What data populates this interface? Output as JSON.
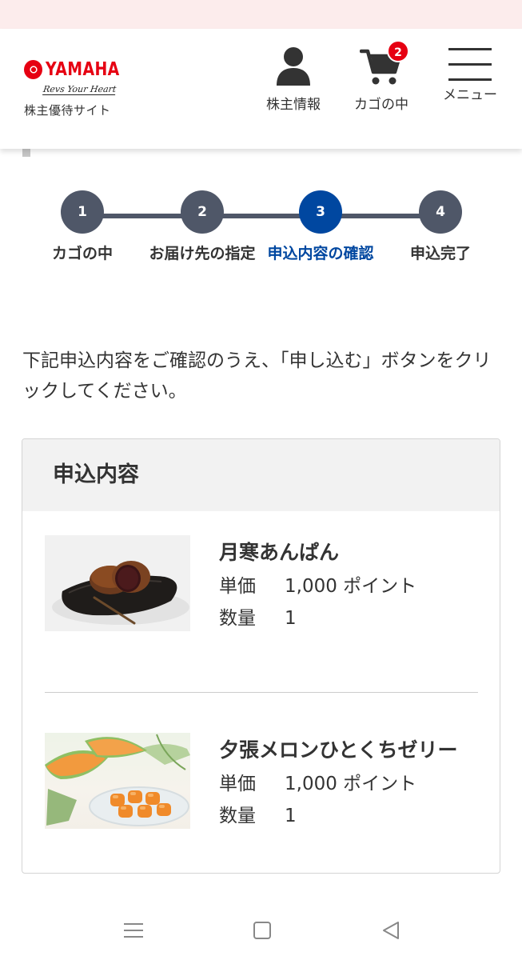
{
  "header": {
    "logo_text": "YAMAHA",
    "logo_tagline": "Revs Your Heart",
    "site_name": "株主優待サイト",
    "nav": {
      "user_label": "株主情報",
      "cart_label": "カゴの中",
      "cart_count": "2",
      "menu_label": "メニュー"
    }
  },
  "steps": [
    {
      "number": "1",
      "label": "カゴの中"
    },
    {
      "number": "2",
      "label": "お届け先の指定"
    },
    {
      "number": "3",
      "label": "申込内容の確認"
    },
    {
      "number": "4",
      "label": "申込完了"
    }
  ],
  "active_step": "3",
  "instruction": "下記申込内容をご確認のうえ、「申し込む」ボタンをクリックしてください。",
  "order": {
    "heading": "申込内容",
    "price_label": "単価",
    "qty_label": "数量",
    "items": [
      {
        "name": "月寒あんぱん",
        "price": "1,000 ポイント",
        "quantity": "1"
      },
      {
        "name": "夕張メロンひとくちゼリー",
        "price": "1,000 ポイント",
        "quantity": "1"
      }
    ]
  },
  "colors": {
    "brand_red": "#e60012",
    "step_inactive": "#4f5768",
    "step_active": "#0047a0"
  },
  "icons": {
    "user": "user-icon",
    "cart": "cart-icon",
    "menu": "hamburger-menu-icon"
  }
}
